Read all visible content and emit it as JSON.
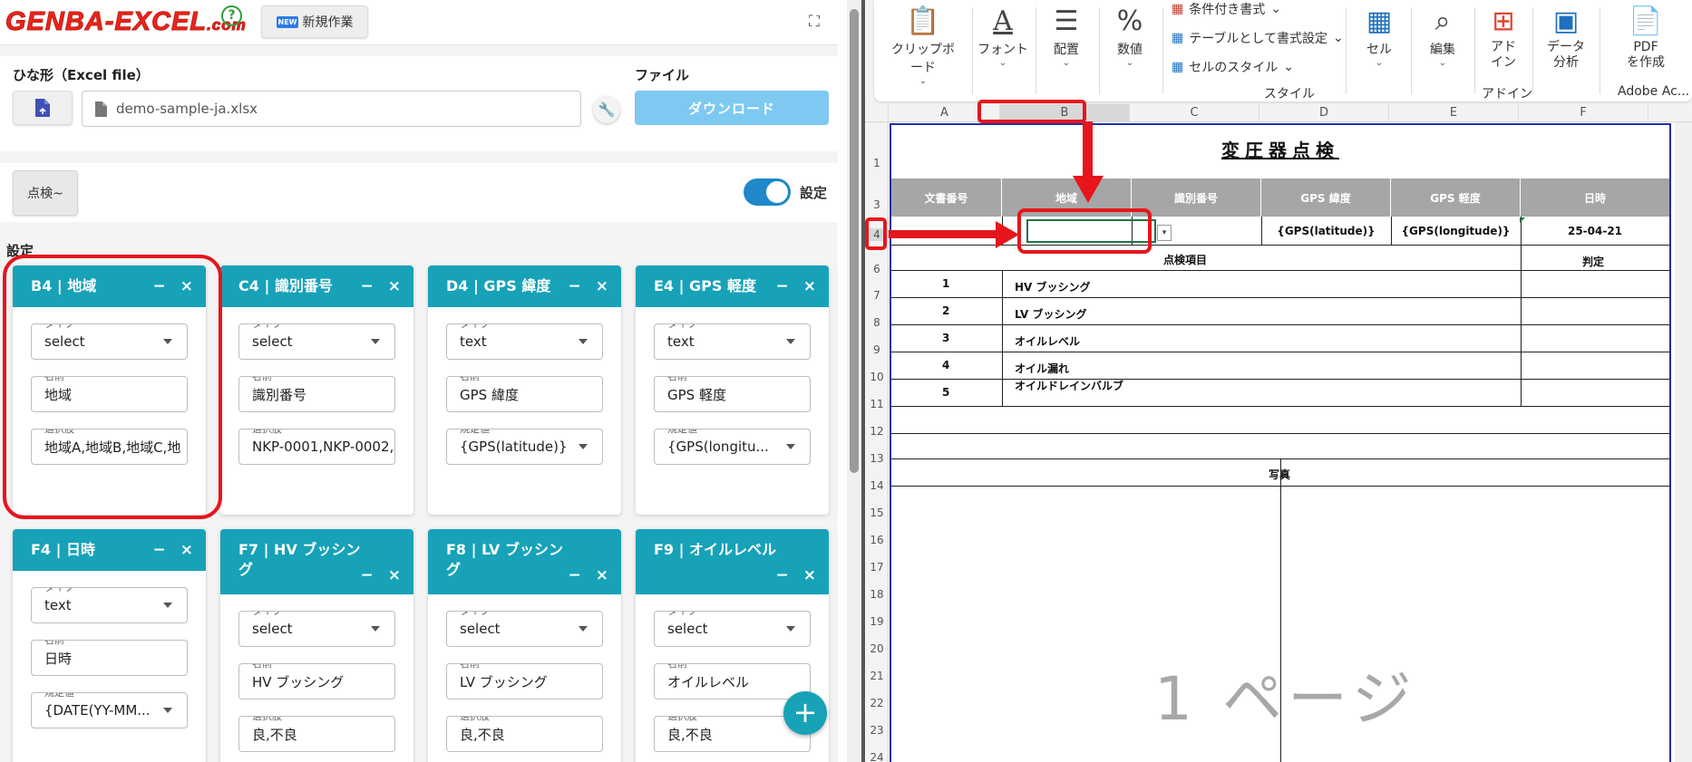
{
  "app": {
    "logo": "GENBA-EXCEL",
    "logo_suffix": ".com",
    "help_icon": "?",
    "new_button": "新規作業",
    "new_badge": "NEW"
  },
  "file_section": {
    "template_label": "ひな形（Excel file）",
    "file_label": "ファイル",
    "file_name": "demo-sample-ja.xlsx",
    "download_button": "ダウンロード"
  },
  "tabs": {
    "active_tab": "点検~",
    "toggle_label": "設定",
    "toggle_on": true
  },
  "settings_title": "設定",
  "cards": [
    {
      "title": "B4 | 地域",
      "f1_label": "タイプ",
      "f1": "select",
      "f2_label": "名前",
      "f2": "地域",
      "f3_label": "選択肢",
      "f3": "地域A,地域B,地域C,地"
    },
    {
      "title": "C4 | 識別番号",
      "f1_label": "タイプ",
      "f1": "select",
      "f2_label": "名前",
      "f2": "識別番号",
      "f3_label": "選択肢",
      "f3": "NKP-0001,NKP-0002,"
    },
    {
      "title": "D4 | GPS 緯度",
      "f1_label": "タイプ",
      "f1": "text",
      "f2_label": "名前",
      "f2": "GPS 緯度",
      "f3_label": "規定値",
      "f3": "{GPS(latitude)}"
    },
    {
      "title": "E4 | GPS 軽度",
      "f1_label": "タイプ",
      "f1": "text",
      "f2_label": "名前",
      "f2": "GPS 軽度",
      "f3_label": "規定値",
      "f3": "{GPS(longitu..."
    },
    {
      "title": "F4 | 日時",
      "f1_label": "タイプ",
      "f1": "text",
      "f2_label": "名前",
      "f2": "日時",
      "f3_label": "規定値",
      "f3": "{DATE(YY-MM..."
    },
    {
      "title": "F7 | HV ブッシング",
      "f1_label": "タイプ",
      "f1": "select",
      "f2_label": "名前",
      "f2": "HV ブッシング",
      "f3_label": "選択肢",
      "f3": "良,不良"
    },
    {
      "title": "F8 | LV ブッシング",
      "f1_label": "タイプ",
      "f1": "select",
      "f2_label": "名前",
      "f2": "LV ブッシング",
      "f3_label": "選択肢",
      "f3": "良,不良"
    },
    {
      "title": "F9 | オイルレベル",
      "f1_label": "タイプ",
      "f1": "select",
      "f2_label": "名前",
      "f2": "オイルレベル",
      "f3_label": "選択肢",
      "f3": "良,不良"
    }
  ],
  "ribbon": {
    "clipboard": "クリップボード",
    "font": "フォント",
    "align": "配置",
    "number": "数値",
    "cond_format": "条件付き書式",
    "table_format": "テーブルとして書式設定",
    "cell_style": "セルのスタイル",
    "style_group": "スタイル",
    "cell": "セル",
    "edit": "編集",
    "addin_1": "アド",
    "addin_2": "イン",
    "addin_group": "アドイン",
    "data_1": "データ",
    "data_2": "分析",
    "pdf_1": "PDF",
    "pdf_2": "を作成",
    "adobe_group": "Adobe Ac..."
  },
  "sheet": {
    "columns": [
      "A",
      "B",
      "C",
      "D",
      "E",
      "F"
    ],
    "rows": [
      "1",
      "",
      "3",
      "4",
      "",
      "6",
      "7",
      "8",
      "9",
      "10",
      "11",
      "12",
      "13",
      "14",
      "15",
      "16",
      "17",
      "18",
      "19",
      "20",
      "21",
      "22",
      "23",
      "24"
    ],
    "title": "変圧器点検",
    "headers": [
      "文書番号",
      "地域",
      "識別番号",
      "GPS 緯度",
      "GPS 軽度",
      "日時"
    ],
    "row4": {
      "lat": "{GPS(latitude)}",
      "lon": "{GPS(longitude)}",
      "date": "25-04-21"
    },
    "item_header": "点検項目",
    "judge_header": "判定",
    "items": [
      {
        "no": "1",
        "name": "HV ブッシング"
      },
      {
        "no": "2",
        "name": "LV ブッシング"
      },
      {
        "no": "3",
        "name": "オイルレベル"
      },
      {
        "no": "4",
        "name": "オイル漏れ"
      },
      {
        "no": "5",
        "name": "オイルドレインバルブ"
      }
    ],
    "photo_header": "写真",
    "watermark": "1 ページ"
  }
}
